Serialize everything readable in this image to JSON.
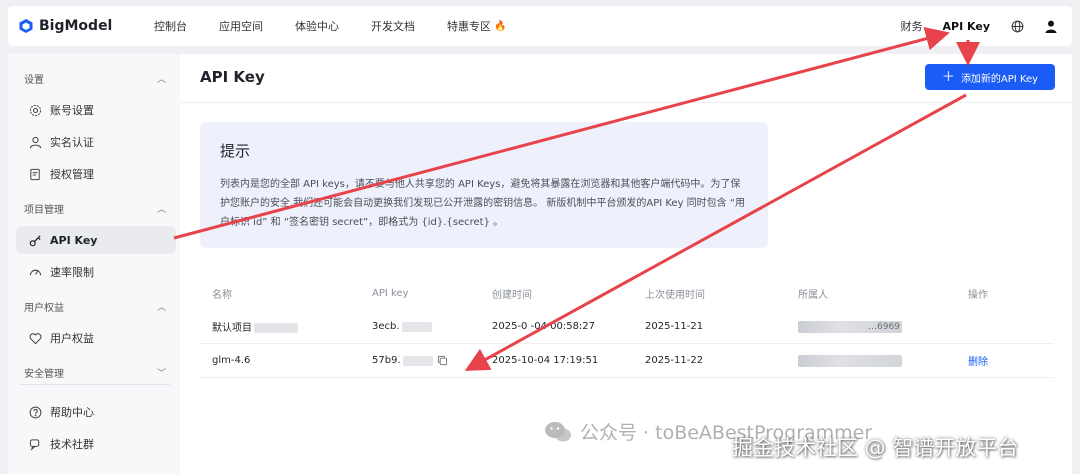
{
  "brand": {
    "name": "BigModel",
    "accent": "#1a5cf5"
  },
  "nav": {
    "items": [
      "控制台",
      "应用空间",
      "体验中心",
      "开发文档",
      "特惠专区"
    ],
    "right": {
      "finance": "财务",
      "api_key": "API Key"
    }
  },
  "sidebar": {
    "groups": {
      "settings": "设置",
      "project": "项目管理",
      "rights": "用户权益",
      "security": "安全管理"
    },
    "items": {
      "account": "账号设置",
      "realname": "实名认证",
      "auth": "授权管理",
      "apikey": "API Key",
      "ratelimit": "速率限制",
      "userrights": "用户权益",
      "help": "帮助中心",
      "community": "技术社群"
    }
  },
  "main": {
    "title": "API Key",
    "add_button": "添加新的API Key",
    "tip": {
      "title": "提示",
      "text": "列表内是您的全部 API keys，请不要与他人共享您的 API Keys，避免将其暴露在浏览器和其他客户端代码中。为了保护您账户的安全,我们还可能会自动更换我们发现已公开泄露的密钥信息。 新版机制中平台颁发的API Key 同时包含 “用户标识 id” 和 “签名密钥 secret”，即格式为 {id}.{secret} 。"
    },
    "table": {
      "headers": [
        "名称",
        "API key",
        "创建时间",
        "上次使用时间",
        "所属人",
        "操作"
      ],
      "rows": [
        {
          "name": "默认项目",
          "key": "3ecb.",
          "created": "2025-0 -04 00:58:27",
          "last_used": "2025-11-21",
          "owner_suffix": "…6969",
          "action": ""
        },
        {
          "name": "glm-4.6",
          "key": "57b9.",
          "created": "2025-10-04 17:19:51",
          "last_used": "2025-11-22",
          "owner_suffix": "",
          "action": "删除"
        }
      ]
    }
  },
  "watermark": {
    "line1": "公众号 · toBeABestProgrammer",
    "line2": "掘金技术社区 @ 智谱开放平台"
  }
}
